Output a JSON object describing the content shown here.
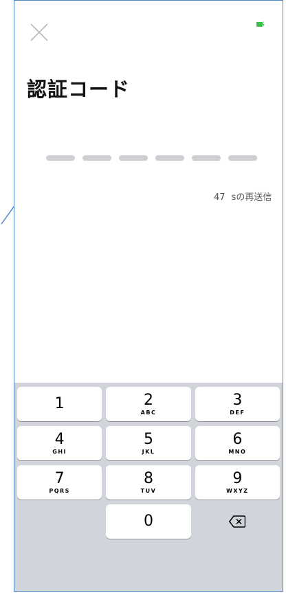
{
  "screen": {
    "title": "認証コード",
    "code_slot_count": 6,
    "resend_countdown": "47",
    "resend_label": "sの再送信",
    "colors": {
      "frame_border": "#4a86c8",
      "slot": "#cfcfd3",
      "keyboard_bg": "#d1d4da",
      "arrow": "#4a86c8",
      "battery": "#3cc24a"
    }
  },
  "keypad": {
    "rows": [
      [
        {
          "digit": "1",
          "letters": ""
        },
        {
          "digit": "2",
          "letters": "ABC"
        },
        {
          "digit": "3",
          "letters": "DEF"
        }
      ],
      [
        {
          "digit": "4",
          "letters": "GHI"
        },
        {
          "digit": "5",
          "letters": "JKL"
        },
        {
          "digit": "6",
          "letters": "MNO"
        }
      ],
      [
        {
          "digit": "7",
          "letters": "PQRS"
        },
        {
          "digit": "8",
          "letters": "TUV"
        },
        {
          "digit": "9",
          "letters": "WXYZ"
        }
      ],
      [
        {
          "digit": "",
          "letters": ""
        },
        {
          "digit": "0",
          "letters": ""
        },
        {
          "digit": "",
          "letters": ""
        }
      ]
    ],
    "delete_icon": "backspace-icon"
  }
}
